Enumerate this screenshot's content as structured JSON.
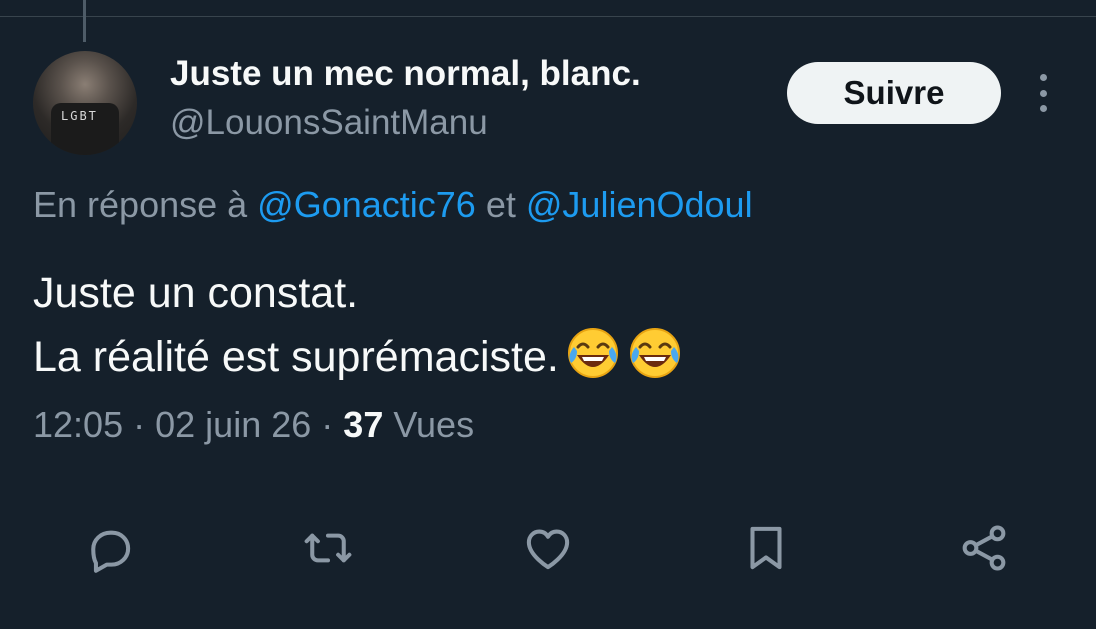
{
  "tweet": {
    "author": {
      "name": "Juste un mec normal, blanc.",
      "handle": "@LouonsSaintManu",
      "avatar_text": "LGBT"
    },
    "follow_button": "Suivre",
    "reply_prefix": "En réponse à",
    "reply_mentions": [
      "@Gonactic76",
      "@JulienOdoul"
    ],
    "reply_joiner": "et",
    "text_lines": [
      "Juste un constat.",
      "La réalité est suprémaciste."
    ],
    "emojis": [
      "face-with-tears-of-joy",
      "face-with-tears-of-joy"
    ],
    "time": "12:05",
    "separator": "·",
    "date": "02 juin 26",
    "views_count": "37",
    "views_label": "Vues"
  },
  "icons": {
    "more": "more-vertical-icon",
    "reply": "reply-icon",
    "retweet": "retweet-icon",
    "like": "heart-icon",
    "bookmark": "bookmark-icon",
    "share": "share-icon"
  },
  "colors": {
    "background": "#15202b",
    "text_primary": "#f7f9f9",
    "text_secondary": "#8b98a5",
    "link": "#1d9bf0",
    "button_bg": "#eff3f4"
  }
}
